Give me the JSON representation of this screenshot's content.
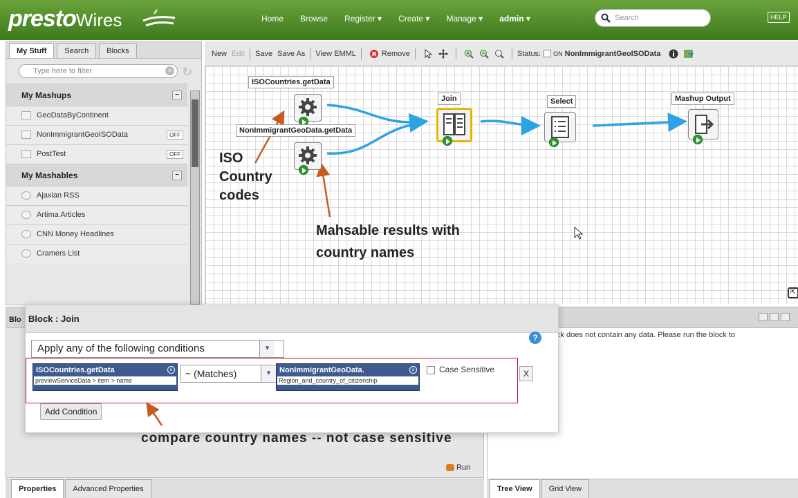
{
  "header": {
    "logo_bold": "presto",
    "logo_rest": "Wires",
    "nav": [
      "Home",
      "Browse",
      "Register ▾",
      "Create ▾",
      "Manage ▾"
    ],
    "user": "admin ▾",
    "search_placeholder": "Search",
    "help": "HELP"
  },
  "left": {
    "tabs": [
      "My Stuff",
      "Search",
      "Blocks"
    ],
    "filter_placeholder": "Type here to filter",
    "mashups_title": "My Mashups",
    "mashups": [
      {
        "label": "GeoDataByContinent",
        "badge": ""
      },
      {
        "label": "NonImmigrantGeoISOData",
        "badge": "OFF"
      },
      {
        "label": "PostTest",
        "badge": "OFF"
      }
    ],
    "mashables_title": "My Mashables",
    "mashables": [
      "Ajaxian RSS",
      "Artima Articles",
      "CNN Money Headlines",
      "Cramers List"
    ]
  },
  "toolbar": {
    "new": "New",
    "edit": "Edit",
    "save": "Save",
    "save_as": "Save As",
    "view_emml": "View EMML",
    "remove": "Remove",
    "status": "Status:",
    "on": "ON",
    "mashup_name": "NonImmigrantGeoISOData"
  },
  "canvas": {
    "labels": {
      "iso": "ISOCountries.getData",
      "nonimm": "NonImmigrantGeoData.getData",
      "join": "Join",
      "select": "Select",
      "output": "Mashup Output"
    },
    "annotations": {
      "iso_lines": [
        "ISO",
        "Country",
        "codes"
      ],
      "mash_lines": [
        "Mahsable results with",
        "country names"
      ]
    }
  },
  "block_panel": {
    "header_prefix": "Blo",
    "run": "Run",
    "tabs": [
      "Properties",
      "Advanced Properties"
    ]
  },
  "right_panel": {
    "message": "ck does not contain any data. Please run the block to",
    "tabs": [
      "Tree View",
      "Grid View"
    ]
  },
  "dialog": {
    "title": "Block : Join",
    "apply_select": "Apply any of the following conditions",
    "left_chip_title": "ISOCountries.getData",
    "left_chip_path": "previewServiceData > item > name",
    "operator": "~ (Matches)",
    "right_chip_title": "NonImmigrantGeoData.",
    "right_chip_path": "Region_and_country_of_citizenship",
    "case_label": "Case Sensitive",
    "remove_x": "X",
    "add_condition": "Add Condition",
    "help": "?"
  },
  "bottom_annotation": "compare country names -- not case sensitive",
  "colors": {
    "header_green": "#4f8d2a",
    "annot_arrow": "#c75a1e",
    "flow_blue": "#2ea3e4",
    "highlight_red": "#c8102e",
    "selected_gold": "#e8b400"
  }
}
